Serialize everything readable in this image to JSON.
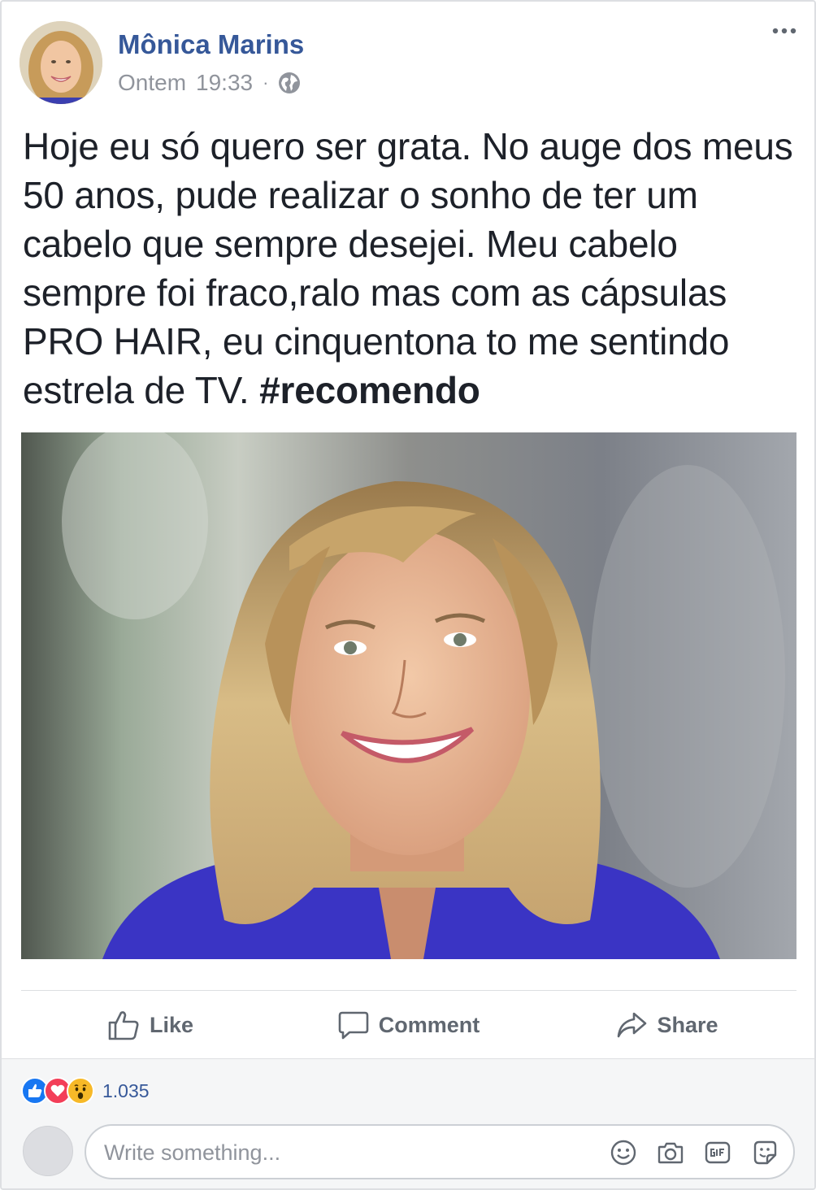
{
  "post": {
    "author": "Mônica Marins",
    "date": "Ontem",
    "time": "19:33",
    "separator": "·",
    "text": "Hoje eu só quero ser grata. No auge dos meus 50 anos, pude realizar o sonho de ter um cabelo que sempre desejei. Meu cabelo sempre foi fraco,ralo mas com as cápsulas PRO HAIR, eu cinquentona to me sentindo estrela de TV.",
    "hashtag": "#recomendo"
  },
  "actions": {
    "like": "Like",
    "comment": "Comment",
    "share": "Share"
  },
  "reactions": {
    "count": "1.035",
    "types": [
      "like",
      "love",
      "wow"
    ]
  },
  "composer": {
    "placeholder": "Write something..."
  },
  "icons": {
    "privacy": "globe-icon",
    "more": "more-options-icon",
    "composer": [
      "emoji-icon",
      "camera-icon",
      "gif-icon",
      "sticker-icon"
    ]
  },
  "colors": {
    "author_link": "#365899",
    "muted_text": "#90949c",
    "action_text": "#606770",
    "like_blue": "#1877f2",
    "love_red": "#f33e58",
    "wow_yellow": "#f7b928",
    "footer_bg": "#f5f6f7"
  }
}
